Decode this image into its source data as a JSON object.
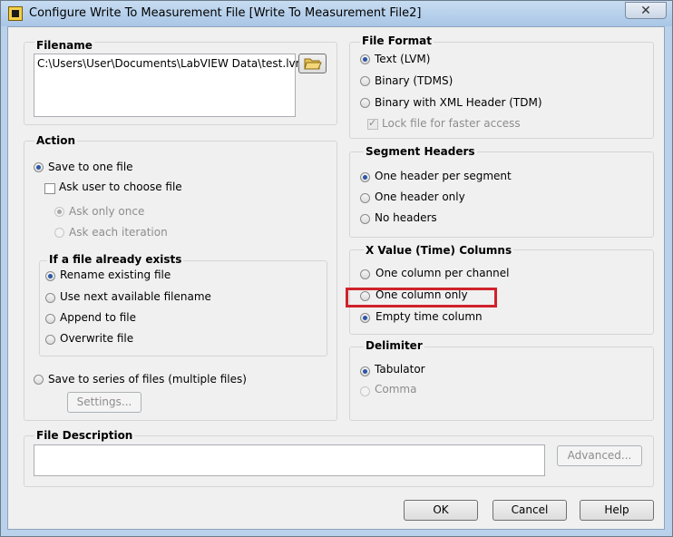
{
  "window": {
    "title": "Configure Write To Measurement File [Write To Measurement File2]",
    "close_label": "✕"
  },
  "filename": {
    "title": "Filename",
    "path": "C:\\Users\\User\\Documents\\LabVIEW Data\\test.lvm"
  },
  "action": {
    "title": "Action",
    "save_one": "Save to one file",
    "ask_user": "Ask user to choose file",
    "ask_once": "Ask only once",
    "ask_each": "Ask each iteration",
    "exists_title": "If a file already exists",
    "rename": "Rename existing file",
    "next_available": "Use next available filename",
    "append": "Append to file",
    "overwrite": "Overwrite file",
    "save_series": "Save to series of files (multiple files)",
    "settings_label": "Settings..."
  },
  "file_format": {
    "title": "File Format",
    "text_lvm": "Text (LVM)",
    "binary_tdms": "Binary (TDMS)",
    "binary_xml": "Binary with XML Header (TDM)",
    "lock_file": "Lock file for faster access"
  },
  "segment_headers": {
    "title": "Segment Headers",
    "per_segment": "One header per segment",
    "only": "One header only",
    "none": "No headers"
  },
  "x_columns": {
    "title": "X Value (Time) Columns",
    "per_channel": "One column per channel",
    "only": "One column only",
    "empty": "Empty time column"
  },
  "delimiter": {
    "title": "Delimiter",
    "tab": "Tabulator",
    "comma": "Comma"
  },
  "description": {
    "title": "File Description",
    "value": "",
    "advanced_label": "Advanced..."
  },
  "footer": {
    "ok": "OK",
    "cancel": "Cancel",
    "help": "Help"
  },
  "colors": {
    "highlight": "#d0222b",
    "radio_selected": "#2b56a6"
  }
}
